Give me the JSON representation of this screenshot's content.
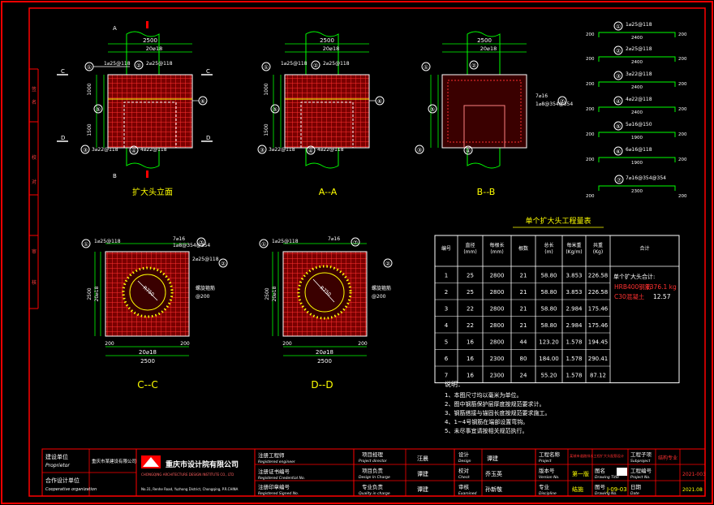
{
  "views": {
    "elevation_title": "扩大头立面",
    "aa_title": "A--A",
    "bb_title": "B--B",
    "cc_title": "C--C",
    "dd_title": "D--D",
    "sec_a": "A",
    "sec_b": "B",
    "sec_c": "C",
    "sec_d": "D"
  },
  "dims": {
    "w2500": "2500",
    "bars20": "20⌀18",
    "h1000": "1000",
    "h1500": "1500",
    "h2500": "2500",
    "side20": "20⌀18",
    "d200": "200",
    "d700": "700",
    "stirrup": "箍筋",
    "spiral_label": "螺旋箍筋",
    "spiral_pitch": "@200",
    "r750": "R750"
  },
  "leaders": {
    "c1": "①",
    "c2": "②",
    "c3": "③",
    "c4": "④",
    "c5": "⑤",
    "c6": "⑥",
    "c7": "⑦",
    "l1": "1⌀25@118",
    "l2": "2⌀25@118",
    "l3": "3⌀22@118",
    "l4": "4⌀22@118",
    "l7a": "7⌀16",
    "l7b": "1⌀8@354@354"
  },
  "bar_shapes": [
    {
      "no": "①",
      "label": "1⌀25@118",
      "left": "200",
      "mid": "2400",
      "right": "200"
    },
    {
      "no": "②",
      "label": "2⌀25@118",
      "left": "200",
      "mid": "2400",
      "right": "200"
    },
    {
      "no": "③",
      "label": "3⌀22@118",
      "left": "200",
      "mid": "2400",
      "right": "200"
    },
    {
      "no": "④",
      "label": "4⌀22@118",
      "left": "200",
      "mid": "2400",
      "right": "200"
    },
    {
      "no": "⑤",
      "label": "5⌀16@150",
      "left": "200",
      "mid": "1900",
      "right": "200"
    },
    {
      "no": "⑥",
      "label": "6⌀16@118",
      "left": "200",
      "mid": "1900",
      "right": "200"
    },
    {
      "no": "⑦",
      "label": "7⌀16@354@354",
      "left": "200",
      "mid": "2300",
      "right": "200"
    }
  ],
  "table": {
    "title": "单个扩大头工程量表",
    "headers": [
      "编号",
      "直径 (mm)",
      "每根长 (mm)",
      "根数",
      "总长 (m)",
      "每米重 (Kg/m)",
      "共重 (Kg)",
      "合计"
    ],
    "rows": [
      [
        "1",
        "25",
        "2800",
        "21",
        "58.80",
        "3.853",
        "226.58"
      ],
      [
        "2",
        "25",
        "2800",
        "21",
        "58.80",
        "3.853",
        "226.58"
      ],
      [
        "3",
        "22",
        "2800",
        "21",
        "58.80",
        "2.984",
        "175.46"
      ],
      [
        "4",
        "22",
        "2800",
        "21",
        "58.80",
        "2.984",
        "175.46"
      ],
      [
        "5",
        "16",
        "2800",
        "44",
        "123.20",
        "1.578",
        "194.45"
      ],
      [
        "6",
        "16",
        "2300",
        "80",
        "184.00",
        "1.578",
        "290.41"
      ],
      [
        "7",
        "16",
        "2300",
        "24",
        "55.20",
        "1.578",
        "87.12"
      ]
    ],
    "total_label": "单个扩大头合计:",
    "hrb_label": "HRB400钢筋",
    "hrb_value": "1376.1 kg",
    "c30_label": "C30混凝土",
    "c30_value": "12.57"
  },
  "notes": {
    "heading": "说明：",
    "items": [
      "1、本图尺寸均以毫米为单位。",
      "2、图中钢筋保护层厚度按规范要求计。",
      "3、钢筋搭接与锚固长度按规范要求施工。",
      "4、1~4号钢筋在端部设置弯钩。",
      "5、未尽事宜请按相关规范执行。"
    ]
  },
  "left_strip": [
    "签",
    "名",
    "校",
    "对",
    "审",
    "核"
  ],
  "title_block": {
    "client_cn": "建设单位",
    "client_en": "Proprietor",
    "client_value": "重庆市某建设有限公司",
    "partner_cn": "合作设计单位",
    "partner_en": "Cooperative organization",
    "company_cn": "重庆市设计院有限公司",
    "company_en": "CHONGQING ARCHITECTURE DESIGN INSTITUTE CO., LTD",
    "company_addr": "No.31, Renhe Road, Yuzhong District, Chongqing, P.R.CHINA",
    "eng_cn": "注册工程师",
    "eng_en": "Registered engineer",
    "reg_cn": "注册证书编号",
    "reg_en": "Registered Credential No.",
    "seal_cn": "注册印章编号",
    "seal_en": "Registered Signed No.",
    "pd_cn": "项目经理",
    "pd_en": "Project director",
    "pm_cn": "项目负责",
    "pm_en": "Design In Charge",
    "qc_cn": "专业负责",
    "qc_en": "Quality in charge",
    "pd_name": "汪晨",
    "pm_name": "谭建",
    "qc_name": "谭建",
    "design_cn": "设计",
    "design_en": "Design",
    "design_name": "谭建",
    "check_cn": "校对",
    "check_en": "Check",
    "check_name": "乔玉英",
    "audit_cn": "审核",
    "audit_en": "Examined",
    "audit_name": "孙新敬",
    "proj_cn": "工程名称",
    "proj_en": "Project",
    "proj_value": "某城市道路排水工程扩大头配筋设计",
    "stage_cn": "版本号",
    "stage_en": "Version No.",
    "stage_value": "第一版",
    "draw_cn": "图名",
    "draw_en": "Drawing Title",
    "draw_value": "扩大头配筋图",
    "major_cn": "工程子项",
    "major_en": "Subproject",
    "major_value": "结构专业",
    "dept_cn": "专业",
    "dept_en": "Discipline",
    "dept_value": "结施",
    "no_cn": "图号",
    "no_en": "Drawing No.",
    "no_value": "J-09-03",
    "scale_cn": "工程编号",
    "scale_en": "Project No.",
    "scale_value": "2021-003",
    "date_cn": "日期",
    "date_en": "Date",
    "date_value": "2021.08"
  },
  "colors": {
    "frame": "#ff0000",
    "outline": "#ffffff",
    "bars": "#ff3333",
    "dim": "#00ff00",
    "text": "#ffff00",
    "leader": "#ffffff"
  }
}
